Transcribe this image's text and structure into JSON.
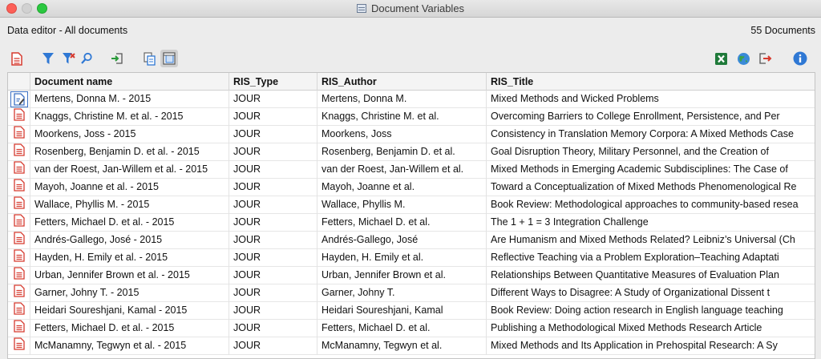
{
  "window": {
    "title": "Document Variables"
  },
  "info": {
    "left": "Data editor - All documents",
    "right": "55 Documents"
  },
  "toolbar": {
    "icons": [
      "document-red-icon",
      "filter-icon",
      "filter-remove-icon",
      "search-icon",
      "import-icon",
      "copy-icon",
      "view-toggle-icon",
      "excel-icon",
      "globe-icon",
      "export-icon",
      "info-icon"
    ]
  },
  "colors": {
    "doc_icon": "#d63a2f",
    "accent": "#2f78d4",
    "excel": "#1f7a3a"
  },
  "table": {
    "headers": [
      "Document name",
      "RIS_Type",
      "RIS_Author",
      "RIS_Title"
    ],
    "rows": [
      [
        "Mertens, Donna M. - 2015",
        "JOUR",
        "Mertens, Donna M.",
        "Mixed Methods and Wicked Problems"
      ],
      [
        "Knaggs, Christine M. et al. - 2015",
        "JOUR",
        "Knaggs, Christine M. et al.",
        "Overcoming Barriers to College Enrollment, Persistence, and Per"
      ],
      [
        "Moorkens, Joss - 2015",
        "JOUR",
        "Moorkens, Joss",
        "Consistency in Translation Memory Corpora: A Mixed Methods Case"
      ],
      [
        "Rosenberg, Benjamin D. et al. - 2015",
        "JOUR",
        "Rosenberg, Benjamin D. et al.",
        "Goal Disruption Theory, Military Personnel, and the Creation of"
      ],
      [
        "van der Roest, Jan-Willem et al. - 2015",
        "JOUR",
        "van der Roest, Jan-Willem et al.",
        "Mixed Methods in Emerging Academic Subdisciplines: The Case of"
      ],
      [
        "Mayoh, Joanne et al. - 2015",
        "JOUR",
        "Mayoh, Joanne et al.",
        "Toward a Conceptualization of Mixed Methods Phenomenological Re"
      ],
      [
        "Wallace, Phyllis M. - 2015",
        "JOUR",
        "Wallace, Phyllis M.",
        "Book Review: Methodological approaches to community-based resea"
      ],
      [
        "Fetters, Michael D. et al. - 2015",
        "JOUR",
        "Fetters, Michael D. et al.",
        "The 1 + 1 = 3 Integration Challenge"
      ],
      [
        "Andrés-Gallego, José - 2015",
        "JOUR",
        "Andrés-Gallego, José",
        "Are Humanism and Mixed Methods Related? Leibniz’s Universal (Ch"
      ],
      [
        "Hayden, H. Emily et al. - 2015",
        "JOUR",
        "Hayden, H. Emily et al.",
        "Reflective Teaching via a Problem Exploration–Teaching Adaptati"
      ],
      [
        "Urban, Jennifer Brown et al. - 2015",
        "JOUR",
        "Urban, Jennifer Brown et al.",
        "Relationships Between Quantitative Measures of Evaluation Plan"
      ],
      [
        "Garner, Johny T. - 2015",
        "JOUR",
        "Garner, Johny T.",
        "Different Ways to Disagree: A Study of Organizational Dissent t"
      ],
      [
        "Heidari Soureshjani, Kamal - 2015",
        "JOUR",
        "Heidari Soureshjani, Kamal",
        "Book Review: Doing action research in English language teaching"
      ],
      [
        "Fetters, Michael D. et al. - 2015",
        "JOUR",
        "Fetters, Michael D. et al.",
        "Publishing a Methodological Mixed Methods Research Article"
      ],
      [
        "McManamny, Tegwyn et al. - 2015",
        "JOUR",
        "McManamny, Tegwyn et al.",
        "Mixed Methods and Its Application in Prehospital Research: A Sy"
      ]
    ],
    "selected_row": 0
  }
}
